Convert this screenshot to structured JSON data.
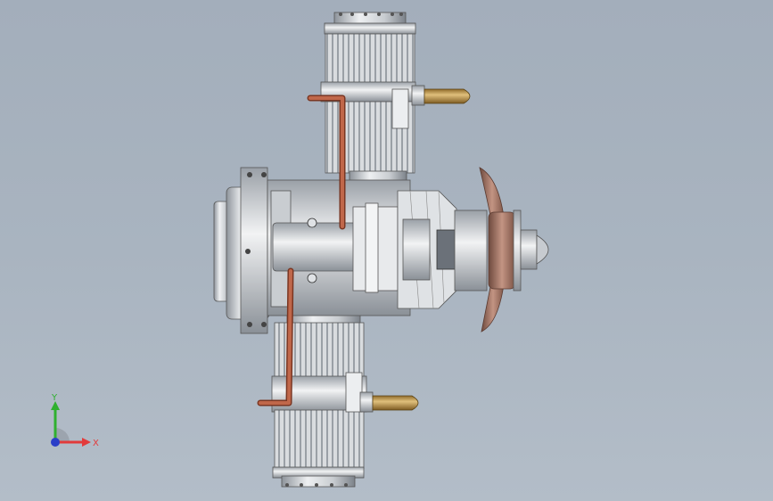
{
  "viewport": {
    "background_top": "#a3aebb",
    "background_bottom": "#b3bdc8"
  },
  "model": {
    "description_icon": "twin-cylinder-engine-model",
    "colors": {
      "metal_light": "#e6e8ea",
      "metal_mid": "#b9bdc2",
      "metal_dark": "#7f858c",
      "copper": "#b0553a",
      "brass": "#c29a52",
      "propeller": "#a8786a"
    }
  },
  "triad": {
    "x_label": "X",
    "y_label": "Y",
    "x_color": "#e23b3b",
    "y_color": "#2fb02f",
    "z_color": "#2a3ec8"
  }
}
